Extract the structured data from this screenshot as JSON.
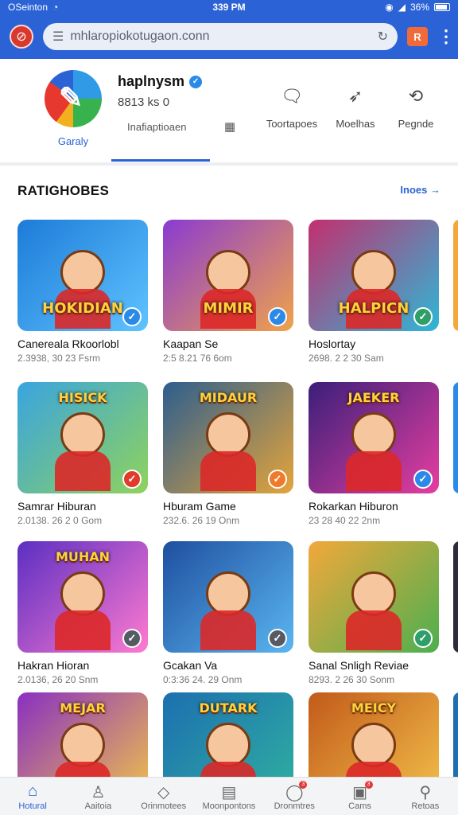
{
  "status_bar": {
    "carrier": "OSeinton",
    "time": "339 PM",
    "battery": "36%"
  },
  "browser": {
    "url": "mhlaropiokotugaon.conn",
    "ext_label": "R"
  },
  "profile": {
    "name": "haplnysm",
    "stats": "8813 ks 0",
    "logo_caption": "Garaly",
    "tab_label": "Inafiaptioaen",
    "actions": [
      {
        "icon": "chat-icon",
        "label": "Toortapoes"
      },
      {
        "icon": "share-icon",
        "label": "Moelhas"
      },
      {
        "icon": "reply-icon",
        "label": "Pegnde"
      }
    ]
  },
  "section": {
    "title": "RATIGHOBES",
    "more": "Inoes →"
  },
  "games": [
    {
      "title": "Canereala Rkoorlobl",
      "meta": "2.3938, 30 23 Fsrm",
      "art": "HOKIDIAN",
      "colors": [
        "#1d7bd8",
        "#5fc3ff"
      ],
      "badge": "#2b8ae8",
      "badge_icon": "✓"
    },
    {
      "title": "Kaapan Se",
      "meta": "2:5 8.21 76 6om",
      "art": "MIMIR",
      "colors": [
        "#8a3bd1",
        "#f0a24a"
      ],
      "badge": "#2b8ae8",
      "badge_icon": "✓"
    },
    {
      "title": "Hoslortay",
      "meta": "2698. 2 2 30 Sam",
      "art": "HALPICN",
      "colors": [
        "#c22f6f",
        "#2fb7d6"
      ],
      "badge": "#2f9f6a",
      "badge_icon": "✓"
    },
    {
      "title": "Samrar Hiburan",
      "meta": "2.0138. 26 2 0 Gom",
      "art": "HISICK",
      "colors": [
        "#39a4e0",
        "#8fd35c"
      ],
      "badge": "#e23b2b",
      "badge_icon": "✓"
    },
    {
      "title": "Hburam Game",
      "meta": "232.6. 26 19 Onm",
      "art": "MIDAUR",
      "colors": [
        "#2c5e8f",
        "#e5a43a"
      ],
      "badge": "#f07a2a",
      "badge_icon": "✓"
    },
    {
      "title": "Rokarkan Hiburon",
      "meta": "23 28 40 22 2nm",
      "art": "JAEKER",
      "colors": [
        "#3a1f7a",
        "#e53ea0"
      ],
      "badge": "#2b8ae8",
      "badge_icon": "✓"
    },
    {
      "title": "Hakran Hioran",
      "meta": "2.0136, 26 20 Snm",
      "art": "MUHAN",
      "colors": [
        "#5b2fc2",
        "#ff7ad0"
      ],
      "badge": "#555a63",
      "badge_icon": "✓"
    },
    {
      "title": "Gcakan Va",
      "meta": "0:3:36 24. 29 Onm",
      "art": "",
      "colors": [
        "#1f4fa0",
        "#5ab6f0"
      ],
      "badge": "#555a63",
      "badge_icon": "✓"
    },
    {
      "title": "Sanal Snligh Reviae",
      "meta": "8293. 2 26 30 Sonm",
      "art": "",
      "colors": [
        "#f2a83a",
        "#4caf50"
      ],
      "badge": "#2f9f6a",
      "badge_icon": "✓"
    },
    {
      "title": "",
      "meta": "",
      "art": "MEJAR",
      "colors": [
        "#8a2fc2",
        "#f0c24a"
      ],
      "badge": "",
      "badge_icon": ""
    },
    {
      "title": "",
      "meta": "",
      "art": "DUTARK",
      "colors": [
        "#1d6fb0",
        "#2fb0a0"
      ],
      "badge": "",
      "badge_icon": ""
    },
    {
      "title": "",
      "meta": "",
      "art": "MEICY",
      "colors": [
        "#c25a1a",
        "#f2c04a"
      ],
      "badge": "",
      "badge_icon": ""
    }
  ],
  "bottom_nav": [
    {
      "icon": "home-icon",
      "label": "Hotural",
      "active": true,
      "dot": ""
    },
    {
      "icon": "user-icon",
      "label": "Aaitoia",
      "active": false,
      "dot": ""
    },
    {
      "icon": "diamond-icon",
      "label": "Orinmotees",
      "active": false,
      "dot": ""
    },
    {
      "icon": "calculator-icon",
      "label": "Moonpontons",
      "active": false,
      "dot": ""
    },
    {
      "icon": "chat-bubble-icon",
      "label": "Dronmtres",
      "active": false,
      "dot": "3"
    },
    {
      "icon": "calendar-icon",
      "label": "Cams",
      "active": false,
      "dot": "3"
    },
    {
      "icon": "search-icon",
      "label": "Retoas",
      "active": false,
      "dot": ""
    }
  ]
}
